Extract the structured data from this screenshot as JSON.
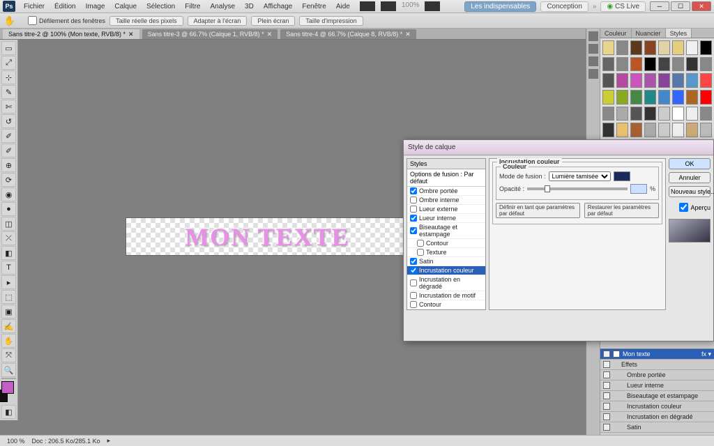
{
  "menu": {
    "items": [
      "Fichier",
      "Édition",
      "Image",
      "Calque",
      "Sélection",
      "Filtre",
      "Analyse",
      "3D",
      "Affichage",
      "Fenêtre",
      "Aide"
    ],
    "logo": "Ps",
    "zoom_disp": "100%",
    "right": {
      "hot": "Les indispensables",
      "conception": "Conception",
      "cslive": "CS Live"
    }
  },
  "options": {
    "defilement": "Défilement des fenêtres",
    "btns": [
      "Taille réelle des pixels",
      "Adapter à l'écran",
      "Plein écran",
      "Taille d'impression"
    ]
  },
  "tabs": [
    {
      "label": "Sans titre-2 @ 100% (Mon texte, RVB/8) *",
      "close": "✕"
    },
    {
      "label": "Sans titre-3 @ 66.7% (Calque 1, RVB/8) *",
      "close": "✕"
    },
    {
      "label": "Sans titre-4 @ 66.7% (Calque 8, RVB/8) *",
      "close": "✕"
    }
  ],
  "tools": [
    "▭",
    "⤢",
    "⊹",
    "✎",
    "✄",
    "↺",
    "✐",
    "✐",
    "⊕",
    "⟳",
    "◉",
    "●",
    "◫",
    "⤫",
    "◧",
    "▣",
    "✍",
    "T",
    "▸",
    "⬚",
    "✋",
    "⤧",
    "🔍"
  ],
  "artwork_text": "MON TEXTE",
  "status": {
    "zoom": "100 %",
    "info": "Doc : 206.5 Ko/285.1 Ko"
  },
  "rp": {
    "tabs": [
      "Couleur",
      "Nuancier",
      "Styles"
    ],
    "swatches": [
      "#e8d48a",
      "#888",
      "#5a3a1a",
      "#884422",
      "#e3d2a8",
      "#e6cf7c",
      "#f0f0f0",
      "#000",
      "#666",
      "#888",
      "#b52",
      "#000",
      "#444",
      "#888",
      "#333",
      "#888",
      "#555",
      "#b44aa0",
      "#cc55bb",
      "#aa55aa",
      "#884499",
      "#5577aa",
      "#5599cc",
      "#ff4444",
      "#cccc33",
      "#88aa22",
      "#448844",
      "#228888",
      "#4488cc",
      "#3366ff",
      "#aa6622",
      "#ff0000",
      "#888888",
      "#aaaaaa",
      "#555555",
      "#333333",
      "#cccccc",
      "#fff",
      "#eeeeee",
      "#888",
      "#333",
      "#e8c070",
      "#a86030",
      "#aaa",
      "#ccc",
      "#eee",
      "#ccaa77",
      "#bbbbbb"
    ]
  },
  "layers": {
    "top": "Mon texte",
    "fx": "Effets",
    "fxlist": [
      "Ombre portée",
      "Lueur interne",
      "Biseautage et estampage",
      "Incrustation couleur",
      "Incrustation en dégradé",
      "Satin"
    ]
  },
  "dialog": {
    "title": "Style de calque",
    "left": {
      "header": "Styles",
      "sub": "Options de fusion : Par défaut",
      "items": [
        {
          "l": "Ombre portée",
          "c": true
        },
        {
          "l": "Ombre interne",
          "c": false
        },
        {
          "l": "Lueur externe",
          "c": false
        },
        {
          "l": "Lueur interne",
          "c": true
        },
        {
          "l": "Biseautage et estampage",
          "c": true
        },
        {
          "l": "Contour",
          "c": false
        },
        {
          "l": "Texture",
          "c": false
        },
        {
          "l": "Satin",
          "c": true
        },
        {
          "l": "Incrustation couleur",
          "c": true,
          "sel": true
        },
        {
          "l": "Incrustation en dégradé",
          "c": false
        },
        {
          "l": "Incrustation de motif",
          "c": false
        },
        {
          "l": "Contour",
          "c": false
        }
      ]
    },
    "mid": {
      "section": "Incrustation couleur",
      "inner": "Couleur",
      "mode_lbl": "Mode de fusion :",
      "mode_val": "Lumière tamisée",
      "opac_lbl": "Opacité :",
      "opac_val": "",
      "opac_pct": "%",
      "defbtn": "Définir en tant que paramètres par défaut",
      "resetbtn": "Restaurer les paramètres par défaut"
    },
    "right": {
      "ok": "OK",
      "cancel": "Annuler",
      "newstyle": "Nouveau style...",
      "preview": "Aperçu"
    }
  }
}
